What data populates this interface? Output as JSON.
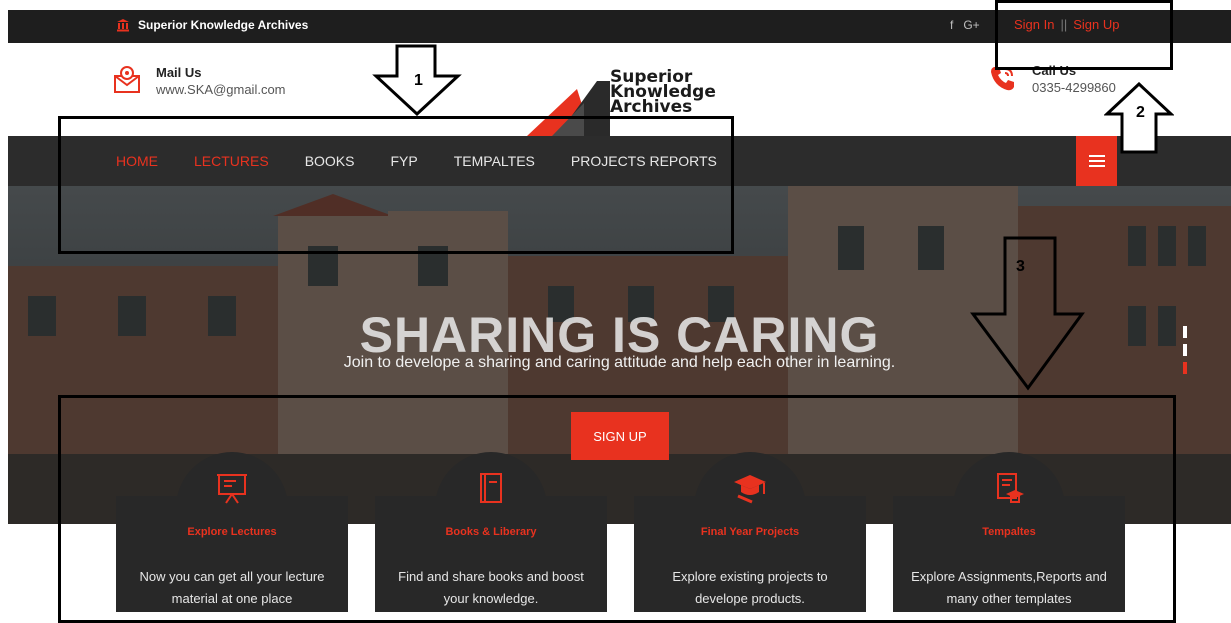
{
  "topbar": {
    "site_name": "Superior Knowledge Archives",
    "social": [
      "f",
      "G+"
    ],
    "sign_in": "Sign In",
    "separator": "||",
    "sign_up": "Sign Up"
  },
  "header": {
    "mail_title": "Mail Us",
    "mail_value": "www.SKA@gmail.com",
    "call_title": "Call Us",
    "call_value": "0335-4299860",
    "logo_lines": [
      "Superior",
      "Knowledge",
      "Archives"
    ]
  },
  "nav": {
    "items": [
      {
        "label": "HOME",
        "active": true
      },
      {
        "label": "LECTURES",
        "active": true
      },
      {
        "label": "BOOKS",
        "active": false
      },
      {
        "label": "FYP",
        "active": false
      },
      {
        "label": "TEMPALTES",
        "active": false
      },
      {
        "label": "PROJECTS REPORTS",
        "active": false
      }
    ]
  },
  "hero": {
    "title": "SHARING IS CARING",
    "subtitle": "Join to develope a sharing and caring attitude and help each other in learning.",
    "cta": "SIGN UP"
  },
  "cards": [
    {
      "icon": "presentation-board-icon",
      "title": "Explore Lectures",
      "text": "Now you can get all your lecture material at one place"
    },
    {
      "icon": "book-icon",
      "title": "Books & Liberary",
      "text": "Find and share books and boost your knowledge."
    },
    {
      "icon": "graduation-cap-icon",
      "title": "Final Year Projects",
      "text": "Explore existing projects to develope products."
    },
    {
      "icon": "templates-icon",
      "title": "Tempaltes",
      "text": "Explore Assignments,Reports and many other templates"
    }
  ],
  "annotations": [
    "1",
    "2",
    "3"
  ],
  "colors": {
    "accent": "#e8321f",
    "dark": "#1e1e1e",
    "nav": "#2c2c2c",
    "card": "#282828"
  }
}
